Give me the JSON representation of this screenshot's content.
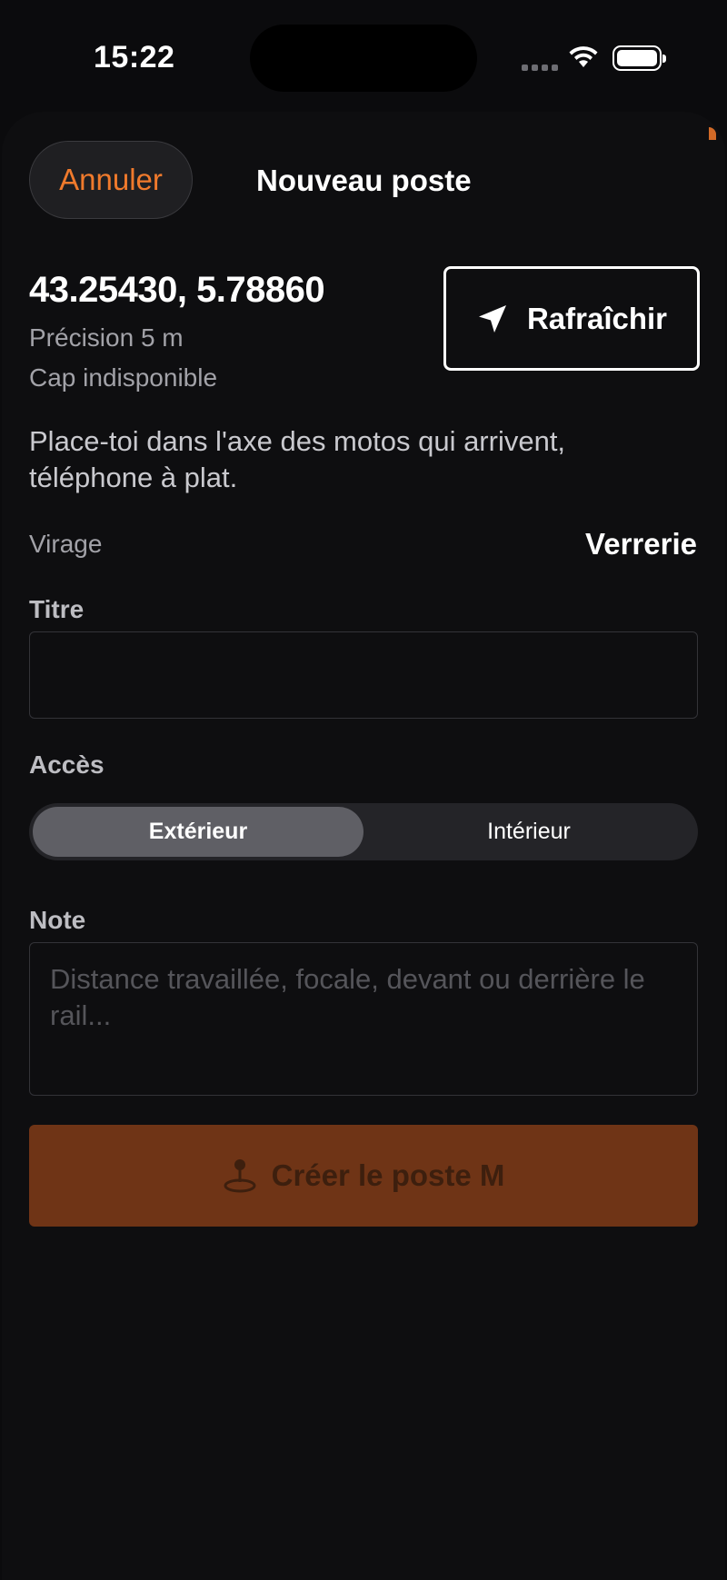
{
  "status_bar": {
    "time": "15:22"
  },
  "nav": {
    "cancel_label": "Annuler",
    "title": "Nouveau poste"
  },
  "location": {
    "coordinates": "43.25430, 5.78860",
    "precision": "Précision 5 m",
    "heading": "Cap indisponible",
    "refresh_label": "Rafraîchir"
  },
  "hint": "Place-toi dans l'axe des motos qui arrivent, téléphone à plat.",
  "virage": {
    "label": "Virage",
    "value": "Verrerie"
  },
  "form": {
    "title_label": "Titre",
    "title_value": "",
    "access_label": "Accès",
    "access_options": [
      "Extérieur",
      "Intérieur"
    ],
    "access_selected": "Extérieur",
    "note_label": "Note",
    "note_placeholder": "Distance travaillée, focale, devant ou derrière le rail...",
    "submit_label": "Créer le poste M"
  },
  "colors": {
    "accent": "#f07a2c",
    "submit_background": "#6f3416",
    "background": "#0e0e10"
  },
  "icons": {
    "refresh": "location-arrow-icon",
    "submit": "pin-icon"
  }
}
